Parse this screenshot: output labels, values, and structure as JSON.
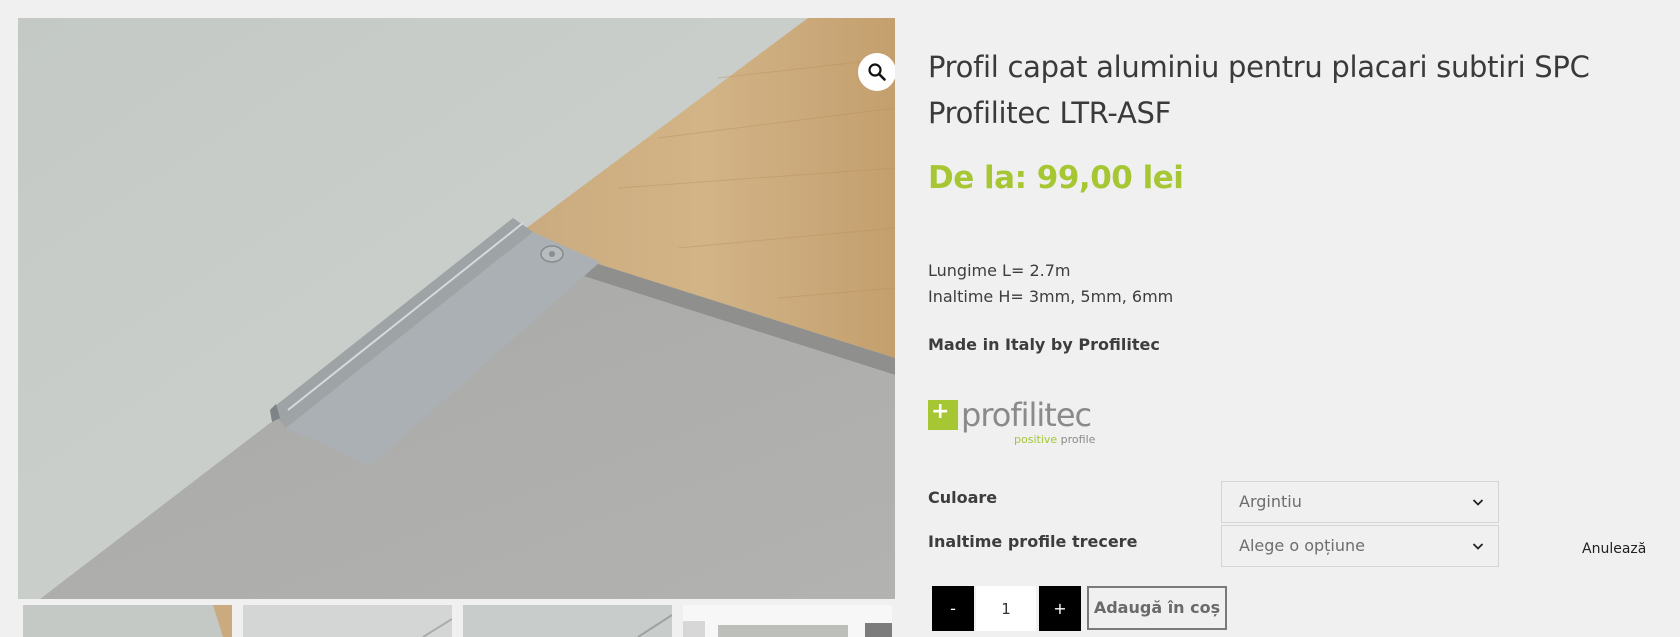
{
  "product": {
    "title": "Profil capat aluminiu pentru placari subtiri SPC Profilitec LTR-ASF",
    "price": "De la: 99,00 lei",
    "description_lines": [
      "Lungime L= 2.7m",
      "Inaltime H= 3mm, 5mm, 6mm"
    ],
    "made_in": "Made in Italy by Profilitec"
  },
  "brand_logo": {
    "mark": "+",
    "wordmark": "profilitec",
    "tagline_green": "positive",
    "tagline_gray": "profile"
  },
  "icons": {
    "zoom": "magnifier-icon",
    "chevron": "chevron-down-icon"
  },
  "variations": [
    {
      "label": "Culoare",
      "selected": "Argintiu"
    },
    {
      "label": "Inaltime profile trecere",
      "selected": "Alege o opțiune"
    }
  ],
  "reset_label": "Anulează",
  "cart": {
    "minus_label": "-",
    "quantity": "1",
    "plus_label": "+",
    "add_label": "Adaugă în coș"
  },
  "colors": {
    "accent_green": "#a6c733",
    "background": "#f0f0f0",
    "button_dark": "#000000"
  }
}
